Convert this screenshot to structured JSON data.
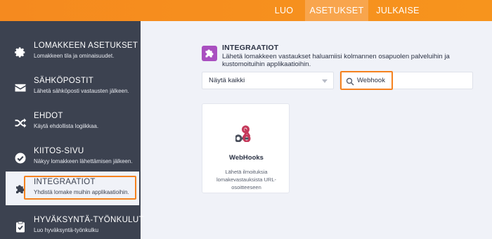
{
  "topbar": {
    "tabs": [
      {
        "label": "LUO",
        "active": false
      },
      {
        "label": "ASETUKSET",
        "active": true
      },
      {
        "label": "JULKAISE",
        "active": false
      }
    ]
  },
  "sidebar": {
    "items": [
      {
        "icon": "gear-icon",
        "title": "LOMAKKEEN ASETUKSET",
        "desc": "Lomakkeen tila ja ominaisuudet."
      },
      {
        "icon": "envelope-icon",
        "title": "SÄHKÖPOSTIT",
        "desc": "Lähetä sähköposti vastausten jälkeen."
      },
      {
        "icon": "shuffle-icon",
        "title": "EHDOT",
        "desc": "Käytä ehdollista logiikkaa."
      },
      {
        "icon": "check-circle-icon",
        "title": "KIITOS-SIVU",
        "desc": "Näkyy lomakkeen lähettämisen jälkeen."
      },
      {
        "icon": "puzzle-icon",
        "title": "INTEGRAATIOT",
        "desc": "Yhdistä lomake muihin applikaatioihin.",
        "active": true
      },
      {
        "icon": "clipboard-check-icon",
        "title": "HYVÄKSYNTÄ-TYÖNKULUT",
        "desc": "Luo hyväksyntä-työnkulku"
      }
    ]
  },
  "main": {
    "title": "INTEGRAATIOT",
    "description": "Lähetä lomakkeen vastaukset haluamiisi kolmannen osapuolen palveluihin ja kustomoituihin applikaatioihin.",
    "filter": {
      "selected": "Näytä kaikki"
    },
    "search": {
      "value": "Webhook"
    },
    "cards": [
      {
        "icon": "webhook-icon",
        "name": "WebHooks",
        "description": "Lähetä ilmoituksia lomakevastauksista URL-osoitteeseen"
      }
    ]
  },
  "colors": {
    "accent": "#f7941d",
    "sidebar": "#3c4250",
    "highlight": "#f5821f",
    "integration_icon": "#a94fc0",
    "webhook": "#c53a5b"
  }
}
